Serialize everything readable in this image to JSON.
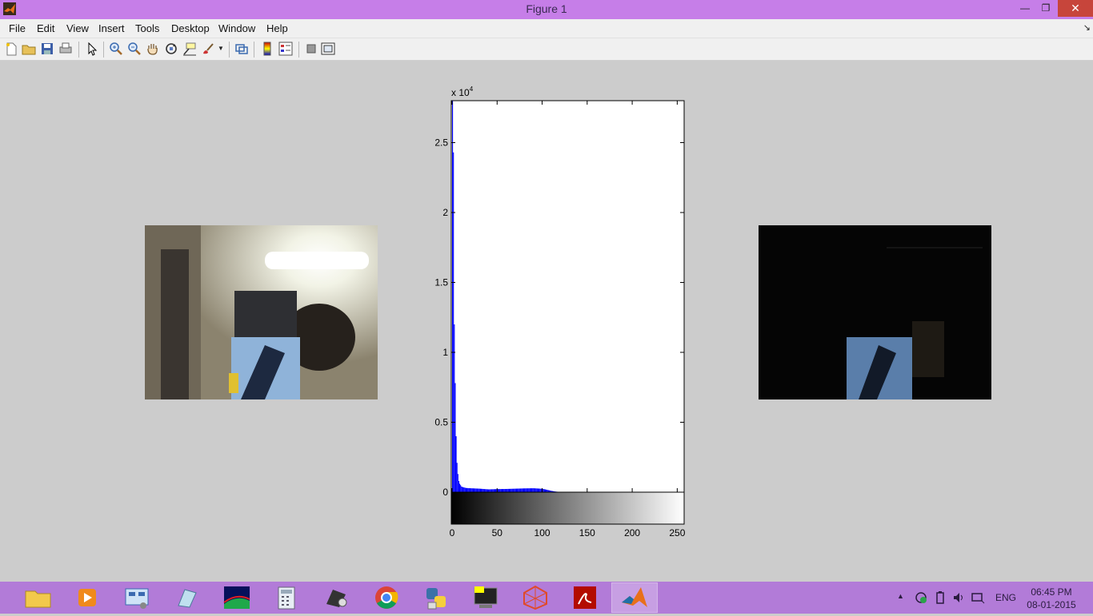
{
  "window": {
    "title": "Figure 1"
  },
  "menu": [
    "File",
    "Edit",
    "View",
    "Insert",
    "Tools",
    "Desktop",
    "Window",
    "Help"
  ],
  "toolbar": {
    "buttons": [
      "new-figure",
      "open-file",
      "save-figure",
      "print-figure",
      "edit-plot",
      "zoom-in",
      "zoom-out",
      "pan",
      "rotate-3d",
      "data-cursor",
      "brush",
      "link-plot",
      "insert-colorbar",
      "insert-legend",
      "hide-plot-tools",
      "show-plot-tools"
    ]
  },
  "chart_data": {
    "type": "bar",
    "title": "",
    "xlabel": "",
    "ylabel": "",
    "y_exponent_label": "x 10",
    "y_exponent": "4",
    "xlim": [
      0,
      255
    ],
    "ylim": [
      0,
      28000
    ],
    "x_ticks": [
      "0",
      "50",
      "100",
      "150",
      "200",
      "250"
    ],
    "y_ticks": [
      "0",
      "0.5",
      "1",
      "1.5",
      "2",
      "2.5"
    ],
    "bar_color": "#0000ff",
    "x": [
      0,
      1,
      2,
      3,
      4,
      5,
      6,
      7,
      8,
      9,
      10,
      12,
      15,
      20,
      30,
      40,
      50,
      60,
      70,
      80,
      90,
      100,
      105,
      110,
      115,
      120,
      150,
      200,
      255
    ],
    "values": [
      28000,
      24300,
      12000,
      7800,
      4000,
      2100,
      1300,
      800,
      600,
      500,
      400,
      350,
      300,
      280,
      250,
      200,
      220,
      230,
      250,
      270,
      280,
      240,
      170,
      90,
      40,
      10,
      0,
      0,
      0
    ],
    "colorbar": "grayscale 0-255"
  },
  "taskbar": {
    "apps": [
      "file-explorer",
      "media-player",
      "control-panel",
      "notepad",
      "photo-viewer",
      "calculator",
      "disc-tool",
      "chrome",
      "python",
      "terminal",
      "3d-app",
      "adobe-reader",
      "matlab"
    ],
    "tray_lang": "ENG",
    "time": "06:45 PM",
    "date": "08-01-2015"
  }
}
